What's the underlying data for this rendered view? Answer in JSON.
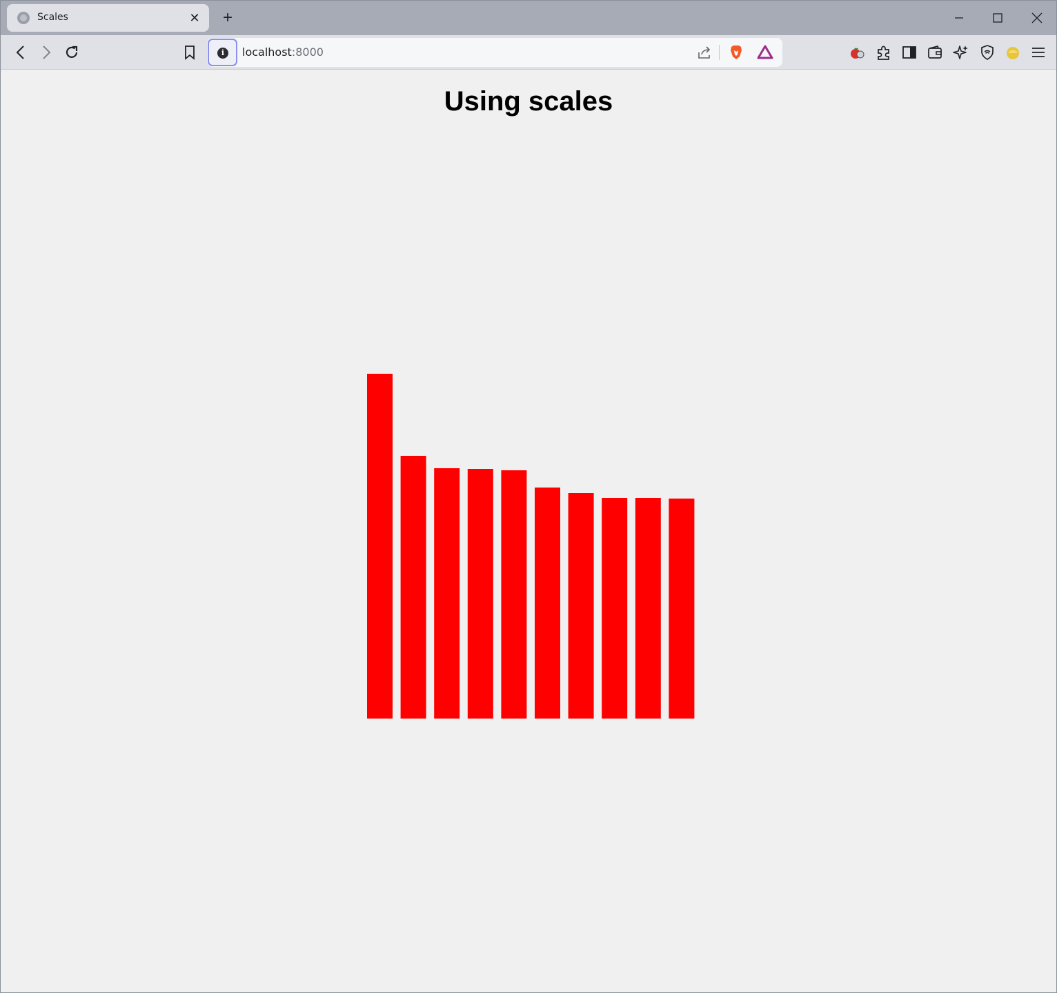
{
  "browser": {
    "tab": {
      "title": "Scales",
      "close_label": "✕"
    },
    "new_tab_label": "+",
    "address": {
      "host": "localhost",
      "port": ":8000"
    }
  },
  "page": {
    "heading": "Using scales"
  },
  "colors": {
    "bar": "#ff0000",
    "background": "#f0f0f0"
  },
  "icons": [
    "globe-icon",
    "close-icon",
    "plus-icon",
    "minimize-icon",
    "maximize-icon",
    "window-close-icon",
    "back-icon",
    "forward-icon",
    "reload-icon",
    "bookmark-icon",
    "info-icon",
    "share-icon",
    "brave-shield-icon",
    "brave-rewards-icon",
    "tomato-extension-icon",
    "puzzle-icon",
    "sidebar-icon",
    "wallet-icon",
    "leo-ai-icon",
    "vpn-icon",
    "coin-extension-icon",
    "menu-icon"
  ],
  "chart_data": {
    "type": "bar",
    "values": [
      500,
      381,
      363,
      362,
      360,
      335,
      327,
      320,
      320,
      319
    ],
    "ylim": [
      0,
      500
    ],
    "grid": false,
    "legend": "none"
  }
}
